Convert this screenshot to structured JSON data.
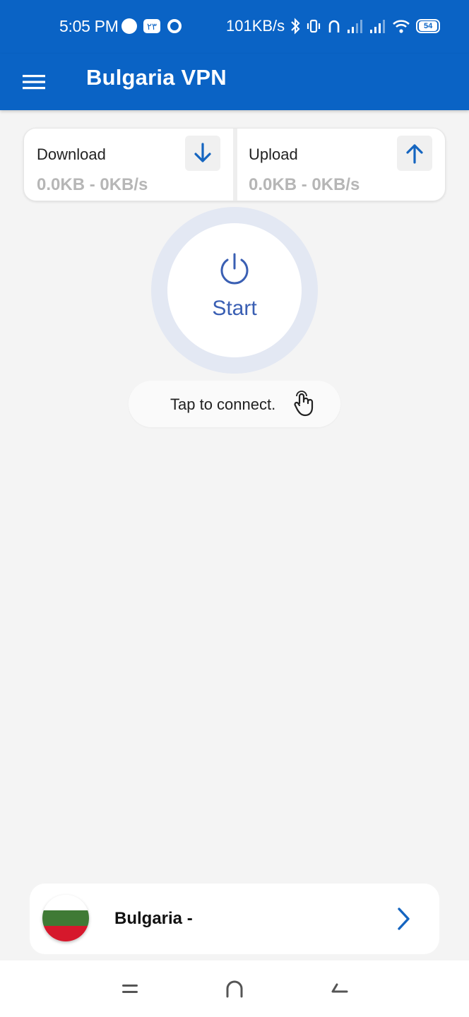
{
  "status_bar": {
    "time": "5:05 PM",
    "network_speed": "101KB/s",
    "battery": "54",
    "icons": [
      "circle-icon",
      "notification-badge-icon",
      "ring-icon",
      "bluetooth-icon",
      "vibrate-icon",
      "headset-icon",
      "signal-icon",
      "signal-icon",
      "wifi-icon",
      "battery-icon"
    ]
  },
  "app_bar": {
    "title": "Bulgaria VPN",
    "menu_icon": "hamburger-menu-icon"
  },
  "stats": {
    "download": {
      "label": "Download",
      "value": "0.0KB - 0KB/s",
      "icon": "arrow-down-icon"
    },
    "upload": {
      "label": "Upload",
      "value": "0.0KB - 0KB/s",
      "icon": "arrow-up-icon"
    }
  },
  "power": {
    "label": "Start",
    "icon": "power-icon"
  },
  "connect_hint": {
    "text": "Tap to connect.",
    "icon": "tap-hand-icon"
  },
  "server": {
    "name": "Bulgaria -",
    "flag_icon": "bulgaria-flag-icon",
    "chevron_icon": "chevron-right-icon"
  },
  "nav": {
    "recents_icon": "recents-icon",
    "home_icon": "home-icon",
    "back_icon": "back-icon"
  },
  "colors": {
    "primary": "#0a63c5",
    "accent_blue": "#3a5fb3",
    "icon_blue": "#1565c0",
    "background": "#f4f4f4",
    "muted_text": "#b6b6b6",
    "flag_white": "#ffffff",
    "flag_green": "#3f7a35",
    "flag_red": "#d6182c"
  }
}
